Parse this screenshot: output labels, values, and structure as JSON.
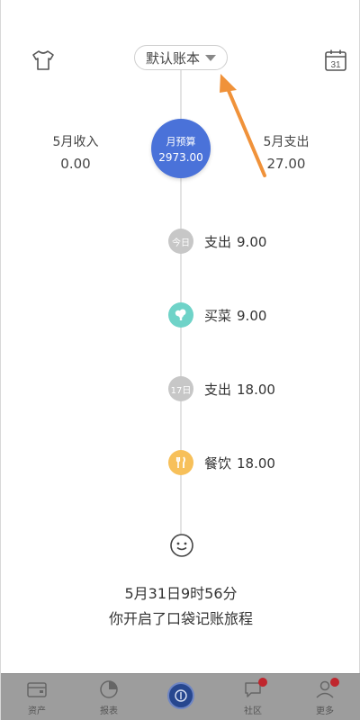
{
  "header": {
    "book_name": "默认账本",
    "calendar_day": "31",
    "skin_icon": "tshirt-icon",
    "calendar_icon": "calendar-icon"
  },
  "summary": {
    "income_label": "5月收入",
    "income_value": "0.00",
    "expense_label": "5月支出",
    "expense_value": "27.00",
    "budget_label": "月预算",
    "budget_value": "2973.00",
    "budget_color": "#4a72d9"
  },
  "timeline": {
    "entries": [
      {
        "badge": "今日",
        "category": "支出",
        "amount": "9.00",
        "icon": "date-badge"
      },
      {
        "badge": "",
        "category": "买菜",
        "amount": "9.00",
        "icon": "vegetable-icon"
      },
      {
        "badge": "17日",
        "category": "支出",
        "amount": "18.00",
        "icon": "date-badge"
      },
      {
        "badge": "",
        "category": "餐饮",
        "amount": "18.00",
        "icon": "fork-knife-icon"
      }
    ],
    "start_date": "5月31日9时56分",
    "start_message": "你开启了口袋记账旅程"
  },
  "nav": {
    "items": [
      {
        "label": "资产",
        "icon": "wallet-icon"
      },
      {
        "label": "报表",
        "icon": "pie-chart-icon"
      },
      {
        "label": "",
        "icon": "add-record-icon"
      },
      {
        "label": "社区",
        "icon": "chat-icon"
      },
      {
        "label": "更多",
        "icon": "user-icon"
      }
    ]
  },
  "annotation": {
    "arrow_color": "#f0923a"
  }
}
